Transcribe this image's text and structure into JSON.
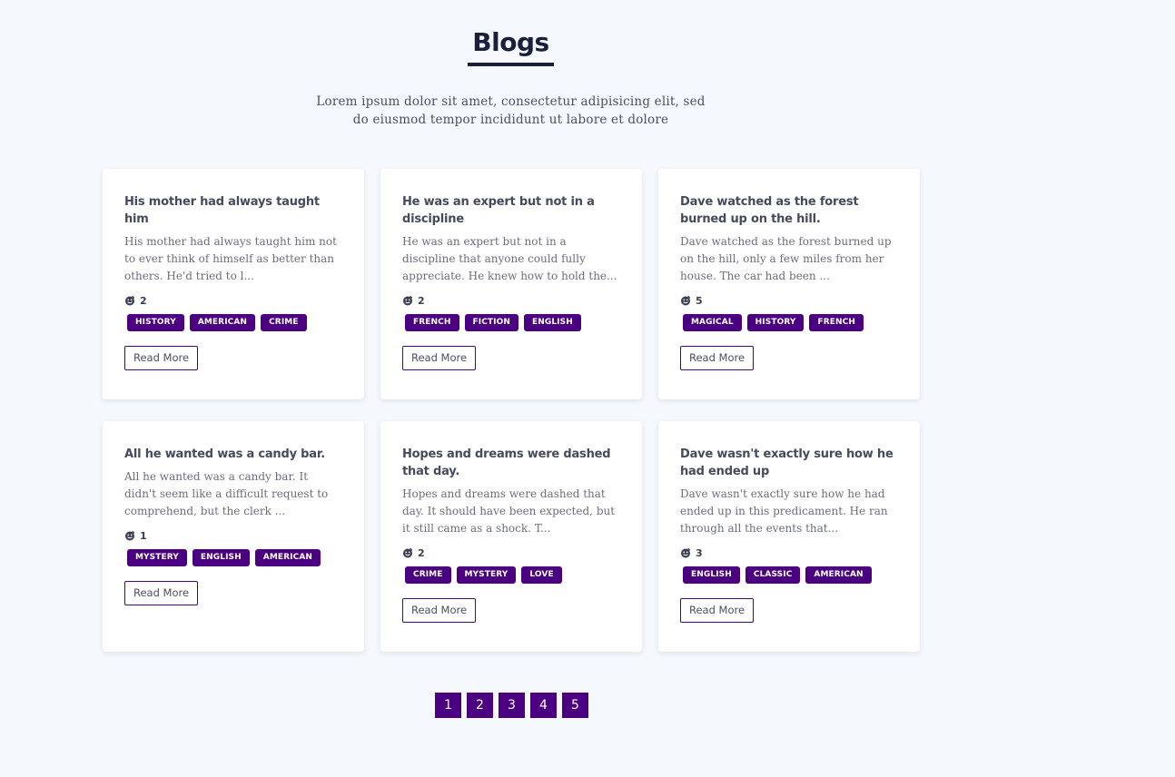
{
  "header": {
    "title": "Blogs",
    "subtitle": "Lorem ipsum dolor sit amet, consectetur adipisicing elit, sed do eiusmod tempor incididunt ut labore et dolore"
  },
  "colors": {
    "accent": "#4b0082",
    "background": "#f5f8fd",
    "title": "#1a1f3b"
  },
  "like_icon": "like-icon",
  "read_more_label": "Read More",
  "posts": [
    {
      "title": "His mother had always taught him",
      "excerpt": "His mother had always taught him not to ever think of himself as better than others. He'd tried to l...",
      "likes": "2",
      "tags": [
        "HISTORY",
        "AMERICAN",
        "CRIME"
      ]
    },
    {
      "title": "He was an expert but not in a discipline",
      "excerpt": "He was an expert but not in a discipline that anyone could fully appreciate. He knew how to hold the...",
      "likes": "2",
      "tags": [
        "FRENCH",
        "FICTION",
        "ENGLISH"
      ]
    },
    {
      "title": "Dave watched as the forest burned up on the hill.",
      "excerpt": "Dave watched as the forest burned up on the hill, only a few miles from her house. The car had been ...",
      "likes": "5",
      "tags": [
        "MAGICAL",
        "HISTORY",
        "FRENCH"
      ]
    },
    {
      "title": "All he wanted was a candy bar.",
      "excerpt": "All he wanted was a candy bar. It didn't seem like a difficult request to comprehend, but the clerk ...",
      "likes": "1",
      "tags": [
        "MYSTERY",
        "ENGLISH",
        "AMERICAN"
      ]
    },
    {
      "title": "Hopes and dreams were dashed that day.",
      "excerpt": "Hopes and dreams were dashed that day. It should have been expected, but it still came as a shock. T...",
      "likes": "2",
      "tags": [
        "CRIME",
        "MYSTERY",
        "LOVE"
      ]
    },
    {
      "title": "Dave wasn't exactly sure how he had ended up",
      "excerpt": "Dave wasn't exactly sure how he had ended up in this predicament. He ran through all the events that...",
      "likes": "3",
      "tags": [
        "ENGLISH",
        "CLASSIC",
        "AMERICAN"
      ]
    }
  ],
  "pagination": [
    "1",
    "2",
    "3",
    "4",
    "5"
  ]
}
